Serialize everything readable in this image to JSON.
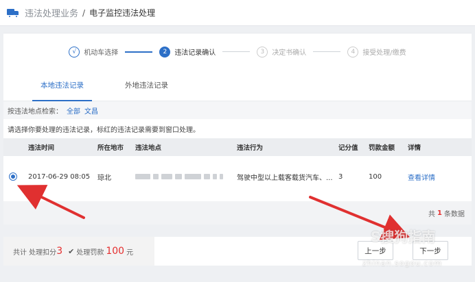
{
  "breadcrumb": {
    "section": "违法处理业务",
    "separator": "/",
    "current": "电子监控违法处理"
  },
  "steps": [
    {
      "index": "√",
      "label": "机动车选择",
      "state": "done"
    },
    {
      "index": "2",
      "label": "违法记录确认",
      "state": "active"
    },
    {
      "index": "3",
      "label": "决定书确认",
      "state": "todo"
    },
    {
      "index": "4",
      "label": "接受处理/缴费",
      "state": "todo"
    }
  ],
  "tabs": [
    {
      "label": "本地违法记录",
      "active": true
    },
    {
      "label": "外地违法记录",
      "active": false
    }
  ],
  "filter": {
    "label": "按违法地点检索：",
    "options": [
      "全部",
      "文昌"
    ]
  },
  "hint": "请选择你要处理的违法记录，标红的违法记录需要到窗口处理。",
  "table": {
    "headers": [
      "违法时间",
      "所在地市",
      "违法地点",
      "违法行为",
      "记分值",
      "罚款金额",
      "详情"
    ],
    "rows": [
      {
        "selected": true,
        "time": "2017-06-29 08:05",
        "city": "琼北",
        "location": "",
        "action": "驾驶中型以上载客载货汽车、...",
        "score": "3",
        "fine": "100",
        "detail": "查看详情"
      }
    ]
  },
  "count": {
    "prefix": "共",
    "num": "1",
    "suffix": "条数据"
  },
  "footer": {
    "summary_prefix": "共计 处理扣分",
    "score": "3",
    "check_label": "处理罚款",
    "fine": "100",
    "unit": "元",
    "prev_label": "上一步",
    "next_label": "下一步"
  },
  "watermark": {
    "main": "S搜狗指南",
    "sub": "zhinan.sogou.com"
  },
  "colors": {
    "accent": "#2c6fc7",
    "highlight": "#e52f2f",
    "arrow": "#e03030"
  }
}
